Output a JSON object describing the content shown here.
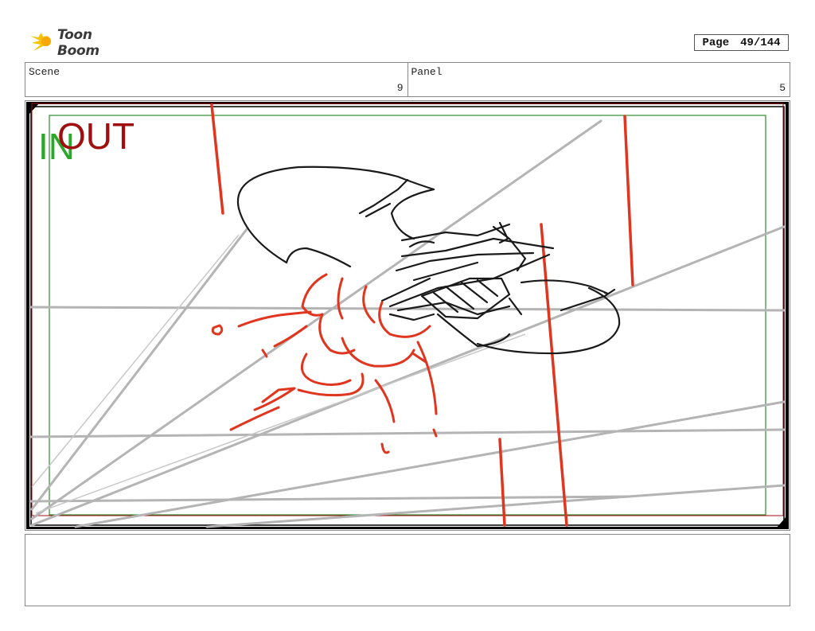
{
  "header": {
    "logo_text": "Toon Boom",
    "page_label": "Page",
    "page_value": "49/144"
  },
  "scene": {
    "label": "Scene",
    "value": "9"
  },
  "panel": {
    "label": "Panel",
    "value": "5"
  },
  "frame_labels": {
    "in": "IN",
    "out": "OUT"
  },
  "colors": {
    "sketch_red": "#e0351e",
    "guide_gray": "#b4b4b4",
    "in_green": "#2aa82a",
    "out_red": "#a00f0f",
    "ink": "#1a1a1a"
  },
  "notes": {
    "text": ""
  }
}
